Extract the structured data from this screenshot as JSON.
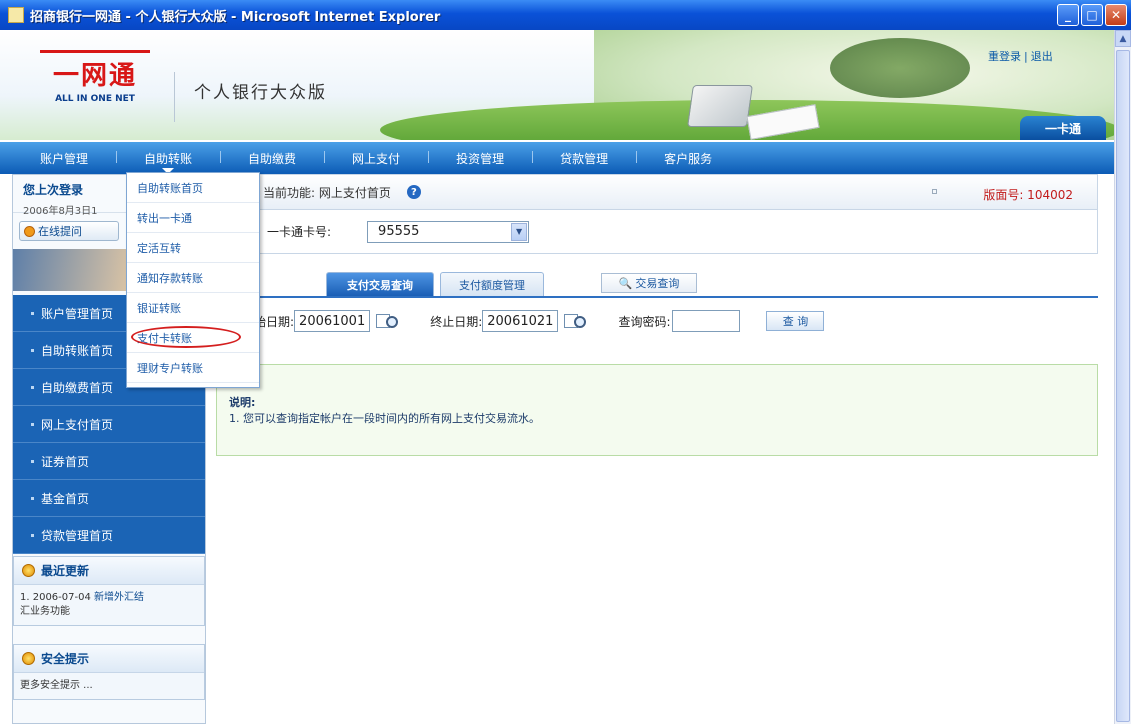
{
  "window": {
    "title": "招商银行一网通 - 个人银行大众版 - Microsoft Internet Explorer",
    "buttons": [
      "_",
      "□",
      "✕"
    ]
  },
  "header": {
    "logo_main": "一网通",
    "logo_sub": "ALL IN ONE NET",
    "slogan": "个人银行大众版",
    "links": [
      "重登录",
      "退出"
    ],
    "card_tab": "一卡通"
  },
  "main_nav": [
    "账户管理",
    "自助转账",
    "自助缴费",
    "网上支付",
    "投资管理",
    "贷款管理",
    "客户服务"
  ],
  "dropdown": [
    "自助转账首页",
    "转出一卡通",
    "定活互转",
    "通知存款转账",
    "银证转账",
    "支付卡转账",
    "理财专户转账"
  ],
  "left": {
    "last_login_title": "您上次登录",
    "last_login_date": "2006年8月3日1",
    "online_label": "在线提问",
    "menu": [
      "账户管理首页",
      "自助转账首页",
      "自助缴费首页",
      "网上支付首页",
      "证券首页",
      "基金首页",
      "贷款管理首页"
    ],
    "updates": {
      "title": "最近更新",
      "prefix": "1. 2006-07-04",
      "new_text": "新增外汇结",
      "rest": "汇业务功能"
    },
    "safety": {
      "title": "安全提示",
      "more": "更多安全提示 ..."
    }
  },
  "content": {
    "breadcrumb": "当前功能: 网上支付首页",
    "help_icon": "?",
    "page_no": "版面号: 104002",
    "card_label": "一卡通卡号:",
    "card_value": "95555",
    "tabs": [
      "支付交易查询",
      "支付额度管理"
    ],
    "trade_query": "交易查询",
    "start_label": "始日期:",
    "start_value": "20061001",
    "end_label": "终止日期:",
    "end_value": "20061021",
    "pwd_label": "查询密码:",
    "query_btn": "查 询",
    "note_title": "说明:",
    "note_text": "1. 您可以查询指定帐户在一段时间内的所有网上支付交易流水。"
  }
}
